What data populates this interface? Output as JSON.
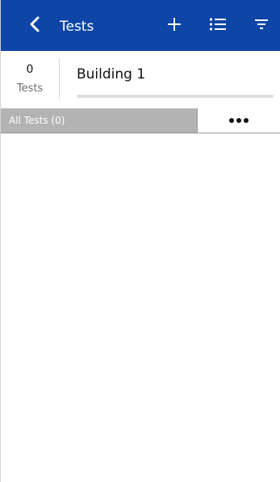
{
  "header": {
    "title": "Tests",
    "back_icon": "chevron-left-icon",
    "add_icon": "plus-icon",
    "list_icon": "list-icon",
    "filter_icon": "filter-icon",
    "background_color": "#0e45a6"
  },
  "summary": {
    "count": "0",
    "count_label": "Tests",
    "building_name": "Building 1",
    "progress": 0
  },
  "group": {
    "label": "All Tests (0)",
    "more_icon": "more-horizontal-icon"
  }
}
